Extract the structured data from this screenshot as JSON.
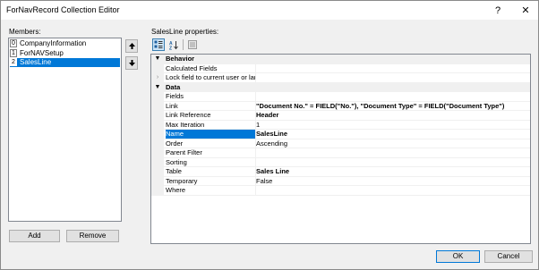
{
  "window": {
    "title": "ForNavRecord Collection Editor",
    "help_glyph": "?",
    "close_glyph": "✕"
  },
  "members": {
    "label": "Members:",
    "items": [
      {
        "index": "0",
        "name": "CompanyInformation",
        "selected": false
      },
      {
        "index": "1",
        "name": "ForNAVSetup",
        "selected": false
      },
      {
        "index": "2",
        "name": "SalesLine",
        "selected": true
      }
    ],
    "add_label": "Add",
    "remove_label": "Remove"
  },
  "properties": {
    "label": "SalesLine properties:",
    "categories": [
      {
        "name": "Behavior",
        "toggle": "▼",
        "rows": [
          {
            "name": "Calculated Fields",
            "value": "",
            "bold": false,
            "expandable": false,
            "selected": false
          },
          {
            "name": "Lock field to current user or lan",
            "value": "",
            "bold": false,
            "expandable": true,
            "selected": false
          }
        ]
      },
      {
        "name": "Data",
        "toggle": "▼",
        "rows": [
          {
            "name": "Fields",
            "value": "",
            "bold": false,
            "expandable": false,
            "selected": false
          },
          {
            "name": "Link",
            "value": "\"Document No.\" = FIELD(\"No.\"), \"Document Type\" = FIELD(\"Document Type\")",
            "bold": true,
            "expandable": false,
            "selected": false
          },
          {
            "name": "Link Reference",
            "value": "Header",
            "bold": true,
            "expandable": false,
            "selected": false
          },
          {
            "name": "Max Iteration",
            "value": "1",
            "bold": false,
            "expandable": false,
            "selected": false
          },
          {
            "name": "Name",
            "value": "SalesLine",
            "bold": true,
            "expandable": false,
            "selected": true
          },
          {
            "name": "Order",
            "value": "Ascending",
            "bold": false,
            "expandable": false,
            "selected": false
          },
          {
            "name": "Parent Filter",
            "value": "",
            "bold": false,
            "expandable": false,
            "selected": false
          },
          {
            "name": "Sorting",
            "value": "",
            "bold": false,
            "expandable": false,
            "selected": false
          },
          {
            "name": "Table",
            "value": "Sales Line",
            "bold": true,
            "expandable": false,
            "selected": false
          },
          {
            "name": "Temporary",
            "value": "False",
            "bold": false,
            "expandable": false,
            "selected": false
          },
          {
            "name": "Where",
            "value": "",
            "bold": false,
            "expandable": false,
            "selected": false
          }
        ]
      }
    ]
  },
  "footer": {
    "ok_label": "OK",
    "cancel_label": "Cancel"
  },
  "colors": {
    "selection": "#0078d7",
    "window_bg": "#f0f0f0"
  }
}
